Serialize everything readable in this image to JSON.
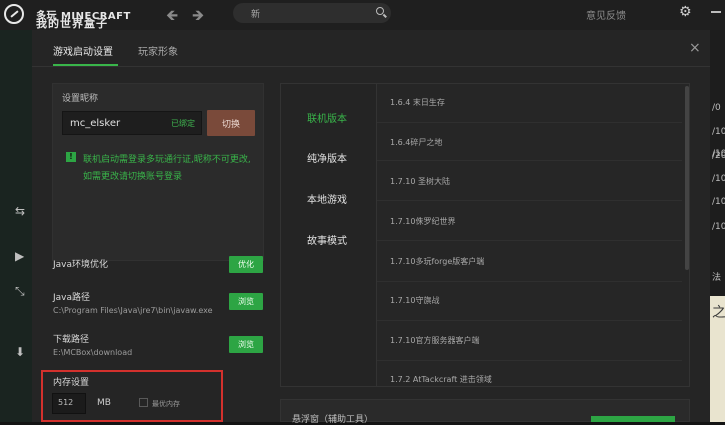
{
  "top_bar": {
    "logo_line1": "多玩 MINECRAFT",
    "logo_line2": "我的世界盒子",
    "search_text": "新",
    "feedback_label": "意见反馈",
    "back_arrow": "🡸",
    "forward_arrow": "🡺",
    "gear_glyph": "⚙"
  },
  "side_icons": [
    "⇆",
    "▶",
    "⤡",
    "⬇"
  ],
  "right_background": {
    "numbers": [
      "/0",
      "/10",
      "/10",
      "/20",
      "/10",
      "/10",
      "/10",
      "法",
      "之"
    ]
  },
  "dialog": {
    "tabs": [
      {
        "label": "游戏启动设置",
        "active": true
      },
      {
        "label": "玩家形象",
        "active": false
      }
    ],
    "close_glyph": "×",
    "nickname": {
      "label": "设置昵称",
      "value": "mc_elsker",
      "bound_label": "已绑定",
      "switch_label": "切换",
      "note_icon": "!",
      "note_line1": "联机启动需登录多玩通行证,昵称不可更改,",
      "note_line2": "如需更改请切换账号登录"
    },
    "java_env": {
      "title": "Java环境优化",
      "button": "优化"
    },
    "java_path": {
      "title": "Java路径",
      "path": "C:\\Program Files\\Java\\jre7\\bin\\javaw.exe",
      "button": "浏览"
    },
    "download_path": {
      "title": "下载路径",
      "path": "E:\\MCBox\\download",
      "button": "浏览"
    },
    "memory": {
      "title": "内存设置",
      "value": "512",
      "unit": "MB",
      "optimal_label": "最优内存",
      "optimal_checked": false
    },
    "categories": [
      {
        "label": "联机版本",
        "active": true
      },
      {
        "label": "纯净版本",
        "active": false
      },
      {
        "label": "本地游戏",
        "active": false
      },
      {
        "label": "故事模式",
        "active": false
      }
    ],
    "versions": [
      "1.6.4 末日生存",
      "1.6.4碎尸之地",
      "1.7.10  圣树大陆",
      "1.7.10侏罗纪世界",
      "1.7.10多玩forge版客户端",
      "1.7.10守旗战",
      "1.7.10官方服务器客户端",
      "1.7.2 AtTackcraft 进击领域"
    ],
    "tool_panel": {
      "label": "悬浮窗（辅助工具）"
    }
  },
  "colors": {
    "accent_green": "#39b54a",
    "button_green": "#2da544",
    "switch_button": "#7a4a3a",
    "highlight_red": "#d3312d"
  }
}
